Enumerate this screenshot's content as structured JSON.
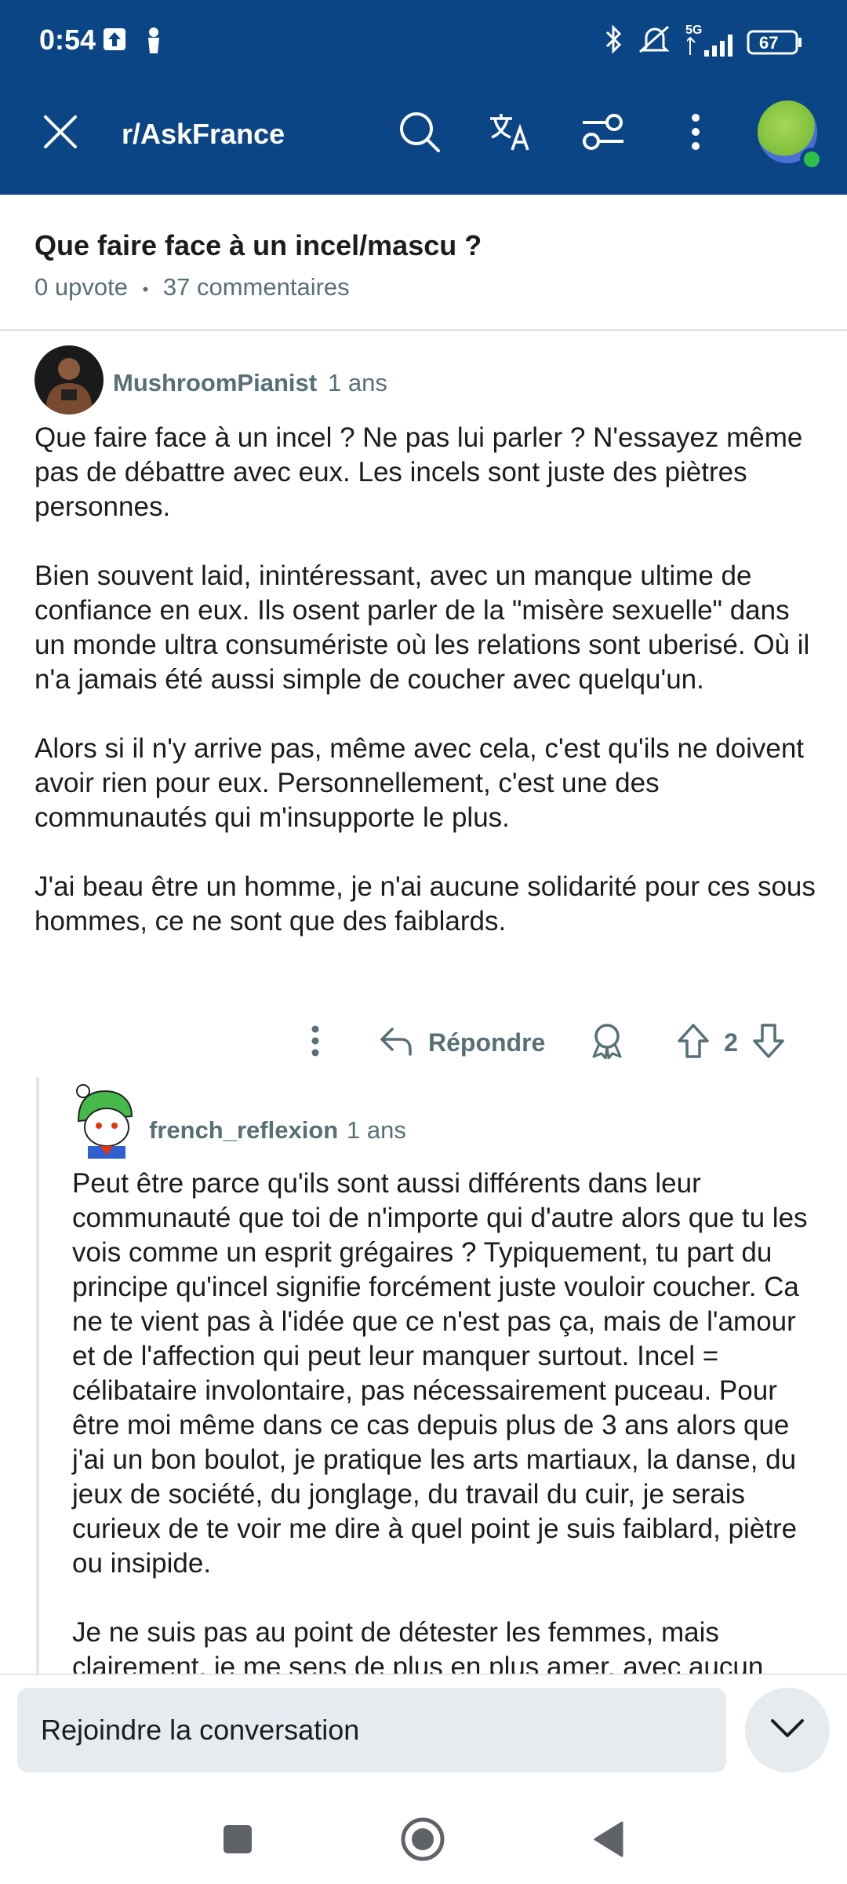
{
  "status_bar": {
    "time": "0:54",
    "network": "5G",
    "battery": "67",
    "icons": [
      "upload-notification-icon",
      "person-notification-icon",
      "bluetooth-icon",
      "silent-icon",
      "signal-icon",
      "battery-icon"
    ]
  },
  "toolbar": {
    "subreddit": "r/AskFrance",
    "icons": [
      "close-icon",
      "search-icon",
      "translate-icon",
      "filter-icon",
      "more-vertical-icon",
      "avatar"
    ]
  },
  "post": {
    "title": "Que faire face à un incel/mascu ?",
    "upvotes": "0 upvote",
    "separator": "•",
    "comments": "37 commentaires"
  },
  "comments": [
    {
      "author": "MushroomPianist",
      "age": "1 ans",
      "paragraphs": [
        "Que faire face à un incel ? Ne pas lui parler ? N'essayez même pas de débattre avec eux. Les incels sont juste des piètres personnes.",
        "Bien souvent laid, inintéressant, avec un manque ultime de confiance en eux. Ils osent parler de la \"misère sexuelle\" dans un monde ultra consumériste où les relations sont uberisé. Où il n'a jamais été aussi simple de coucher avec quelqu'un.",
        "Alors si il n'y arrive pas, même avec cela, c'est qu'ils ne doivent avoir rien pour eux. Personnellement, c'est une des communautés qui m'insupporte le plus.",
        "J'ai beau être un homme, je n'ai aucune solidarité pour ces sous hommes, ce ne sont que des faiblards."
      ],
      "actions": {
        "reply_label": "Répondre",
        "score": "2"
      }
    },
    {
      "author": "french_reflexion",
      "age": "1 ans",
      "paragraphs": [
        "Peut être parce qu'ils sont aussi différents dans leur communauté que toi de n'importe qui d'autre alors que tu les vois comme un esprit grégaires ? Typiquement, tu part du principe qu'incel signifie forcément juste vouloir coucher. Ca ne te vient pas à l'idée que ce n'est pas ça, mais de l'amour et de l'affection qui peut leur manquer surtout. Incel = célibataire involontaire, pas nécessairement puceau. Pour être moi même dans ce cas depuis plus de 3 ans alors que j'ai un bon boulot, je pratique les arts martiaux, la danse, du jeux de société, du jonglage, du travail du cuir, je serais curieux de te voir me dire à quel point je suis faiblard, piètre ou insipide.",
        "Je ne suis pas au point de détester les femmes, mais clairement, je me sens de plus en plus amer, avec aucun"
      ]
    }
  ],
  "composer": {
    "placeholder": "Rejoindre la conversation"
  },
  "colors": {
    "appbar": "#0b4586",
    "meta_text": "#576f76",
    "input_bg": "#e6ebef"
  }
}
